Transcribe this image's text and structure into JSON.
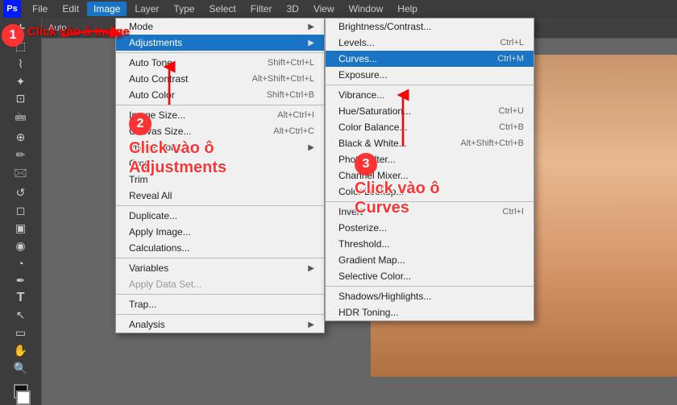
{
  "app": {
    "title": "Adobe Photoshop",
    "logo_text": "Ps"
  },
  "menu_bar": {
    "items": [
      {
        "id": "ps-logo",
        "label": "Ps",
        "active": false
      },
      {
        "id": "file",
        "label": "File",
        "active": false
      },
      {
        "id": "edit",
        "label": "Edit",
        "active": false
      },
      {
        "id": "image",
        "label": "Image",
        "active": true
      },
      {
        "id": "layer",
        "label": "Layer",
        "active": false
      },
      {
        "id": "type",
        "label": "Type",
        "active": false
      },
      {
        "id": "select",
        "label": "Select",
        "active": false
      },
      {
        "id": "filter",
        "label": "Filter",
        "active": false
      },
      {
        "id": "3d",
        "label": "3D",
        "active": false
      },
      {
        "id": "view",
        "label": "View",
        "active": false
      },
      {
        "id": "window",
        "label": "Window",
        "active": false
      },
      {
        "id": "help",
        "label": "Help",
        "active": false
      }
    ]
  },
  "image_menu": {
    "items": [
      {
        "id": "mode",
        "label": "Mode",
        "shortcut": "",
        "has_arrow": true
      },
      {
        "id": "adjustments",
        "label": "Adjustments",
        "shortcut": "",
        "has_arrow": true,
        "highlighted": true
      },
      {
        "id": "sep1",
        "type": "separator"
      },
      {
        "id": "auto-tone",
        "label": "Auto Tone",
        "shortcut": "Shift+Ctrl+L",
        "has_arrow": false
      },
      {
        "id": "auto-contrast",
        "label": "Auto Contrast",
        "shortcut": "Alt+Shift+Ctrl+L",
        "has_arrow": false
      },
      {
        "id": "auto-color",
        "label": "Auto Color",
        "shortcut": "Shift+Ctrl+B",
        "has_arrow": false
      },
      {
        "id": "sep2",
        "type": "separator"
      },
      {
        "id": "image-size",
        "label": "Image Size...",
        "shortcut": "Alt+Ctrl+I",
        "has_arrow": false
      },
      {
        "id": "canvas-size",
        "label": "Canvas Size...",
        "shortcut": "Alt+Ctrl+C",
        "has_arrow": false
      },
      {
        "id": "image-rotation",
        "label": "Image Rotation",
        "shortcut": "",
        "has_arrow": true
      },
      {
        "id": "crop",
        "label": "Crop",
        "shortcut": "",
        "has_arrow": false
      },
      {
        "id": "trim",
        "label": "Trim",
        "shortcut": "",
        "has_arrow": false
      },
      {
        "id": "reveal-all",
        "label": "Reveal All",
        "shortcut": "",
        "has_arrow": false
      },
      {
        "id": "sep3",
        "type": "separator"
      },
      {
        "id": "duplicate",
        "label": "Duplicate...",
        "shortcut": "",
        "has_arrow": false
      },
      {
        "id": "apply-image",
        "label": "Apply Image...",
        "shortcut": "",
        "has_arrow": false
      },
      {
        "id": "calculations",
        "label": "Calculations...",
        "shortcut": "",
        "has_arrow": false
      },
      {
        "id": "sep4",
        "type": "separator"
      },
      {
        "id": "variables",
        "label": "Variables",
        "shortcut": "",
        "has_arrow": true
      },
      {
        "id": "apply-data-set",
        "label": "Apply Data Set...",
        "shortcut": "",
        "has_arrow": false,
        "disabled": true
      },
      {
        "id": "sep5",
        "type": "separator"
      },
      {
        "id": "trap",
        "label": "Trap...",
        "shortcut": "",
        "has_arrow": false
      },
      {
        "id": "sep6",
        "type": "separator"
      },
      {
        "id": "analysis",
        "label": "Analysis",
        "shortcut": "",
        "has_arrow": true
      }
    ]
  },
  "adjustments_submenu": {
    "items": [
      {
        "id": "brightness-contrast",
        "label": "Brightness/Contrast...",
        "shortcut": "",
        "has_arrow": false
      },
      {
        "id": "levels",
        "label": "Levels...",
        "shortcut": "Ctrl+L",
        "has_arrow": false
      },
      {
        "id": "curves",
        "label": "Curves...",
        "shortcut": "Ctrl+M",
        "has_arrow": false,
        "highlighted": true
      },
      {
        "id": "exposure",
        "label": "Exposure...",
        "shortcut": "",
        "has_arrow": false
      },
      {
        "id": "sep1",
        "type": "separator"
      },
      {
        "id": "vibrance",
        "label": "Vibrance...",
        "shortcut": "",
        "has_arrow": false
      },
      {
        "id": "hue-saturation",
        "label": "Hue/Saturation...",
        "shortcut": "Ctrl+U",
        "has_arrow": false
      },
      {
        "id": "color-balance",
        "label": "Color Balance...",
        "shortcut": "Ctrl+B",
        "has_arrow": false
      },
      {
        "id": "black-white",
        "label": "Black & White...",
        "shortcut": "Alt+Shift+Ctrl+B",
        "has_arrow": false
      },
      {
        "id": "photo-filter",
        "label": "Photo Filter...",
        "shortcut": "",
        "has_arrow": false
      },
      {
        "id": "channel-mixer",
        "label": "Channel Mixer...",
        "shortcut": "",
        "has_arrow": false
      },
      {
        "id": "color-lookup",
        "label": "Color Lookup...",
        "shortcut": "",
        "has_arrow": false
      },
      {
        "id": "sep2",
        "type": "separator"
      },
      {
        "id": "invert",
        "label": "Invert",
        "shortcut": "Ctrl+I",
        "has_arrow": false
      },
      {
        "id": "posterize",
        "label": "Posterize...",
        "shortcut": "",
        "has_arrow": false
      },
      {
        "id": "threshold",
        "label": "Threshold...",
        "shortcut": "",
        "has_arrow": false
      },
      {
        "id": "gradient-map",
        "label": "Gradient Map...",
        "shortcut": "",
        "has_arrow": false
      },
      {
        "id": "selective-color",
        "label": "Selective Color...",
        "shortcut": "",
        "has_arrow": false
      },
      {
        "id": "sep3",
        "type": "separator"
      },
      {
        "id": "shadows-highlights",
        "label": "Shadows/Highlights...",
        "shortcut": "",
        "has_arrow": false
      },
      {
        "id": "hdr-toning",
        "label": "HDR Toning...",
        "shortcut": "",
        "has_arrow": false
      }
    ]
  },
  "annotations": {
    "click_image": "Click vào ô\nImage",
    "click_adjustments": "Click vào ô\nAdjustments",
    "click_curves": "Click vào ô\nCurves",
    "step1": "1",
    "step2": "2",
    "step3": "3"
  },
  "options_bar": {
    "auto_label": "Auto"
  }
}
